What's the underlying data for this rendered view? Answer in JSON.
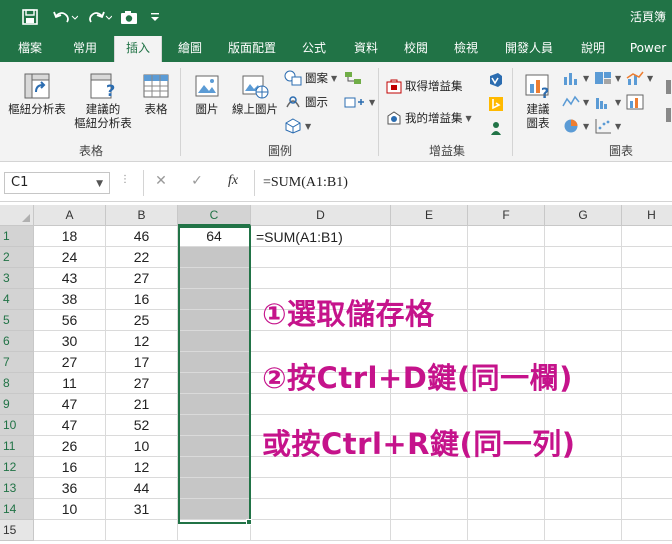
{
  "window": {
    "title": "活頁簿"
  },
  "quick_access": {
    "save_icon": "save-icon",
    "undo_icon": "undo-icon",
    "redo_icon": "redo-icon",
    "camera_icon": "camera-icon",
    "customize_icon": "customize-icon"
  },
  "tabs": [
    {
      "label": "檔案"
    },
    {
      "label": "常用"
    },
    {
      "label": "插入",
      "active": true
    },
    {
      "label": "繪圖"
    },
    {
      "label": "版面配置"
    },
    {
      "label": "公式"
    },
    {
      "label": "資料"
    },
    {
      "label": "校閱"
    },
    {
      "label": "檢視"
    },
    {
      "label": "開發人員"
    },
    {
      "label": "說明"
    },
    {
      "label": "Power"
    }
  ],
  "ribbon": {
    "tables": {
      "label": "表格",
      "pivot_label": "樞紐分析表",
      "recommended_pivot_line1": "建議的",
      "recommended_pivot_line2": "樞紐分析表",
      "table_label": "表格"
    },
    "illustrations": {
      "label": "圖例",
      "pictures_label": "圖片",
      "online_pictures_label": "線上圖片",
      "shapes_label": "圖案",
      "icons_label": "圖示"
    },
    "addins": {
      "label": "增益集",
      "get_addins_label": "取得增益集",
      "my_addins_label": "我的增益集"
    },
    "charts": {
      "label": "圖表",
      "recommended_line1": "建議",
      "recommended_line2": "圖表"
    }
  },
  "formula_bar": {
    "name_box": "C1",
    "cancel_symbol": "✕",
    "enter_symbol": "✓",
    "fx_symbol": "fx",
    "formula": "=SUM(A1:B1)"
  },
  "sheet": {
    "columns": [
      "A",
      "B",
      "C",
      "D",
      "E",
      "F",
      "G",
      "H"
    ],
    "rows": [
      {
        "n": "1",
        "a": "18",
        "b": "46",
        "c": "64"
      },
      {
        "n": "2",
        "a": "24",
        "b": "22",
        "c": ""
      },
      {
        "n": "3",
        "a": "43",
        "b": "27",
        "c": ""
      },
      {
        "n": "4",
        "a": "38",
        "b": "16",
        "c": ""
      },
      {
        "n": "5",
        "a": "56",
        "b": "25",
        "c": ""
      },
      {
        "n": "6",
        "a": "30",
        "b": "12",
        "c": ""
      },
      {
        "n": "7",
        "a": "27",
        "b": "17",
        "c": ""
      },
      {
        "n": "8",
        "a": "11",
        "b": "27",
        "c": ""
      },
      {
        "n": "9",
        "a": "47",
        "b": "21",
        "c": ""
      },
      {
        "n": "10",
        "a": "47",
        "b": "52",
        "c": ""
      },
      {
        "n": "11",
        "a": "26",
        "b": "10",
        "c": ""
      },
      {
        "n": "12",
        "a": "16",
        "b": "12",
        "c": ""
      },
      {
        "n": "13",
        "a": "36",
        "b": "44",
        "c": ""
      },
      {
        "n": "14",
        "a": "10",
        "b": "31",
        "c": ""
      },
      {
        "n": "15",
        "a": "",
        "b": "",
        "c": ""
      }
    ],
    "d1_text": "=SUM(A1:B1)",
    "selected_column": "C"
  },
  "annotations": {
    "line1": "①選取儲存格",
    "line2": "②按Ctrl+D鍵(同一欄)",
    "line3": "或按Ctrl+R鍵(同一列)"
  },
  "colors": {
    "accent": "#217346",
    "annotation": "#c5138b",
    "selection_fill": "#c6c6c6"
  }
}
